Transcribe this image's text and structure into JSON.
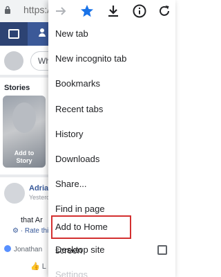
{
  "browser": {
    "url_partial": "https://",
    "icons": [
      "lock-icon",
      "forward-icon",
      "star-icon",
      "download-icon",
      "info-icon",
      "reload-icon"
    ],
    "accent": "#1a73e8"
  },
  "facebook_bg": {
    "brand_color": "#3b5998",
    "composer_placeholder_partial": "Wh",
    "stories_label": "Stories",
    "story_caption": "Add to\nStory",
    "post_author_partial": "Adrian",
    "post_time_partial": "Yesterd",
    "post_text_partial": "that Ar",
    "post_rate_partial": "Rate this",
    "reaction_name_partial": "Jonathan",
    "like_partial": "L"
  },
  "menu": {
    "items": [
      {
        "label": "New tab"
      },
      {
        "label": "New incognito tab"
      },
      {
        "label": "Bookmarks"
      },
      {
        "label": "Recent tabs"
      },
      {
        "label": "History"
      },
      {
        "label": "Downloads"
      },
      {
        "label": "Share..."
      },
      {
        "label": "Find in page"
      },
      {
        "label": "Add to Home screen",
        "highlighted": true
      },
      {
        "label": "Desktop site",
        "has_checkbox": true,
        "checked": false
      },
      {
        "label": "Settings"
      }
    ],
    "highlight_color": "#d32f2f"
  }
}
